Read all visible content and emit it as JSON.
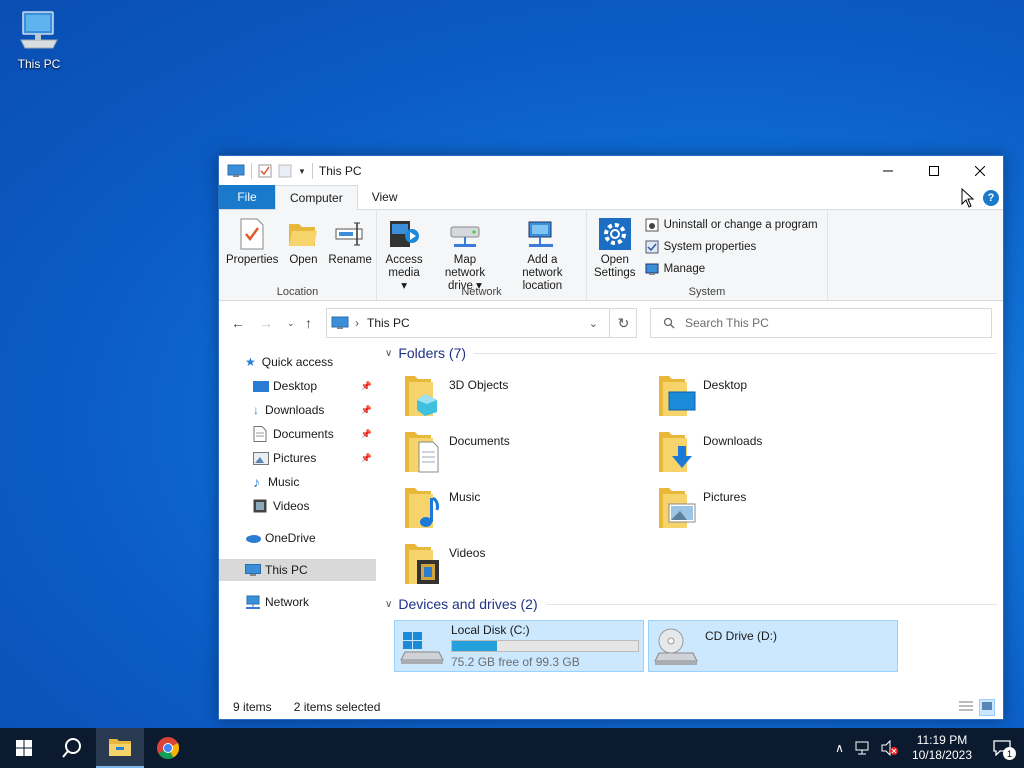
{
  "desktop": {
    "icon_label": "This PC"
  },
  "window": {
    "title": "This PC",
    "tabs": {
      "file": "File",
      "computer": "Computer",
      "view": "View"
    },
    "ribbon": {
      "location": {
        "name": "Location",
        "properties": "Properties",
        "open": "Open",
        "rename": "Rename"
      },
      "network": {
        "name": "Network",
        "access_media_1": "Access",
        "access_media_2": "media",
        "map_drive_1": "Map network",
        "map_drive_2": "drive",
        "add_location_1": "Add a network",
        "add_location_2": "location"
      },
      "system": {
        "name": "System",
        "open_settings_1": "Open",
        "open_settings_2": "Settings",
        "uninstall": "Uninstall or change a program",
        "system_properties": "System properties",
        "manage": "Manage"
      }
    },
    "address": {
      "path": "This PC",
      "search_placeholder": "Search This PC"
    },
    "nav": {
      "quick_access": "Quick access",
      "desktop": "Desktop",
      "downloads": "Downloads",
      "documents": "Documents",
      "pictures": "Pictures",
      "music": "Music",
      "videos": "Videos",
      "onedrive": "OneDrive",
      "this_pc": "This PC",
      "network": "Network"
    },
    "folders_header": "Folders (7)",
    "folders": [
      "3D Objects",
      "Desktop",
      "Documents",
      "Downloads",
      "Music",
      "Pictures",
      "Videos"
    ],
    "devices_header": "Devices and drives (2)",
    "drives": {
      "c_name": "Local Disk (C:)",
      "c_free": "75.2 GB free of 99.3 GB",
      "c_used_fraction": 0.243,
      "d_name": "CD Drive (D:)"
    },
    "status": {
      "items": "9 items",
      "selected": "2 items selected"
    }
  },
  "taskbar": {
    "time": "11:19 PM",
    "date": "10/18/2023",
    "notification_count": "1"
  },
  "colors": {
    "accent": "#1979ca",
    "selection": "#cce8ff",
    "header_text": "#1e3287"
  }
}
